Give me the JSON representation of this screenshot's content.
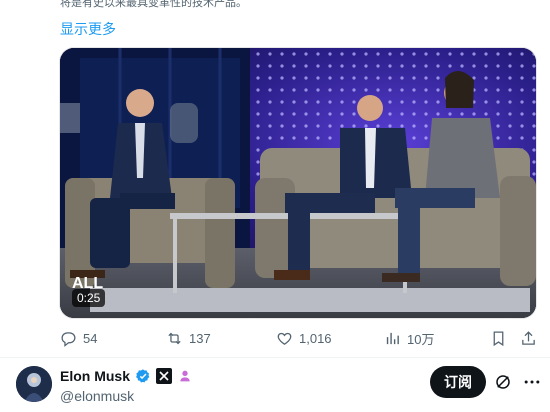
{
  "tweet": {
    "text_partial": "将是有史以来最具变革性的技术产品。",
    "show_more_label": "显示更多"
  },
  "video": {
    "duration": "0:25",
    "overlay_text": "ALL"
  },
  "actions": {
    "replies": "54",
    "reposts": "137",
    "likes": "1,016",
    "views": "10万"
  },
  "author": {
    "name": "Elon Musk",
    "handle": "@elonmusk",
    "subscribe_label": "订阅"
  },
  "colors": {
    "accent": "#1d9bf0",
    "verified": "#1d9bf0",
    "muted": "#536471",
    "subscribe_bg": "#0f1419"
  },
  "icons": [
    "reply-icon",
    "repost-icon",
    "like-icon",
    "views-icon",
    "bookmark-icon",
    "share-icon",
    "verified-badge-icon",
    "x-logo-icon",
    "affiliate-icon",
    "grok-icon",
    "more-icon"
  ]
}
